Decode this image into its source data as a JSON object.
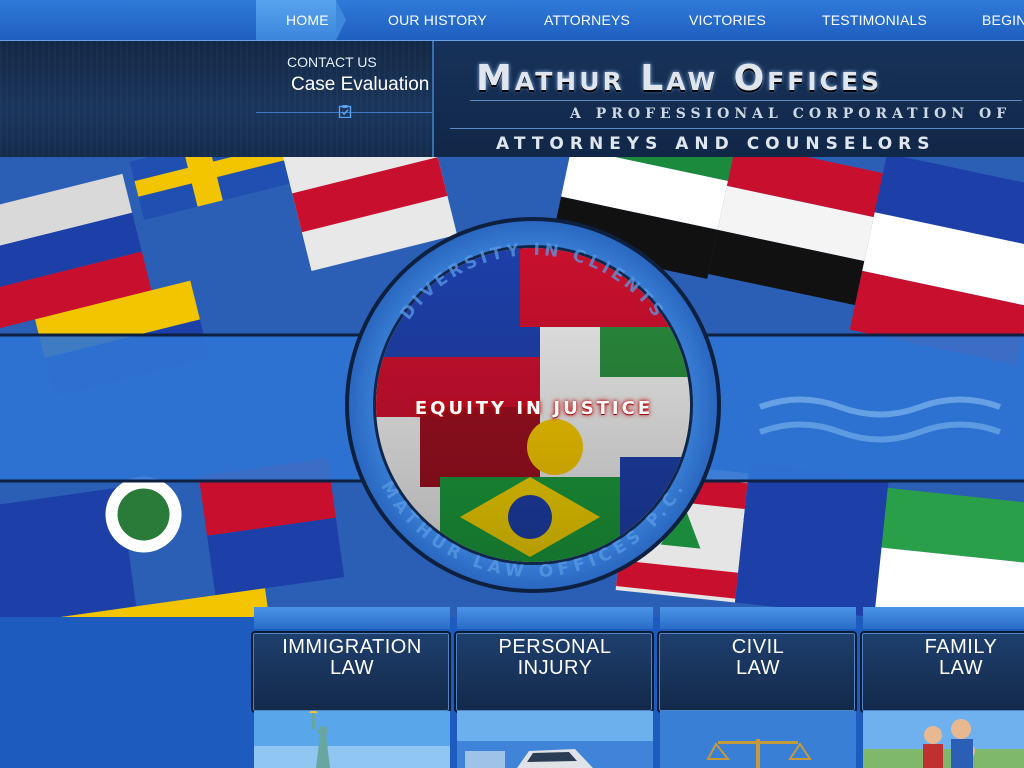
{
  "nav": {
    "items": [
      {
        "label": "HOME",
        "active": true
      },
      {
        "label": "OUR HISTORY"
      },
      {
        "label": "ATTORNEYS"
      },
      {
        "label": "VICTORIES"
      },
      {
        "label": "TESTIMONIALS"
      },
      {
        "label": "BEGIN"
      }
    ]
  },
  "header": {
    "contact_label": "CONTACT US",
    "case_eval_label": "Case Evaluation",
    "firm_name": "Mathur Law Offices",
    "tagline_1": "A PROFESSIONAL CORPORATION OF",
    "tagline_2": "ATTORNEYS AND COUNSELORS"
  },
  "banner": {
    "ring_top_text": "DIVERSITY IN CLIENTS",
    "ring_bottom_text": "MATHUR LAW OFFICES P.C.",
    "slogan": "EQUITY IN JUSTICE"
  },
  "practice_areas": [
    {
      "line1": "IMMIGRATION",
      "line2": "LAW",
      "image": "statue-of-liberty"
    },
    {
      "line1": "PERSONAL",
      "line2": "INJURY",
      "image": "car-crash"
    },
    {
      "line1": "CIVIL",
      "line2": "LAW",
      "image": "scales-of-justice"
    },
    {
      "line1": "FAMILY",
      "line2": "LAW",
      "image": "family-photo"
    }
  ],
  "colors": {
    "nav_bg": "#2a6fd0",
    "header_bg": "#17325a",
    "accent_blue": "#3c86dc",
    "slogan_glow": "#c01010"
  }
}
